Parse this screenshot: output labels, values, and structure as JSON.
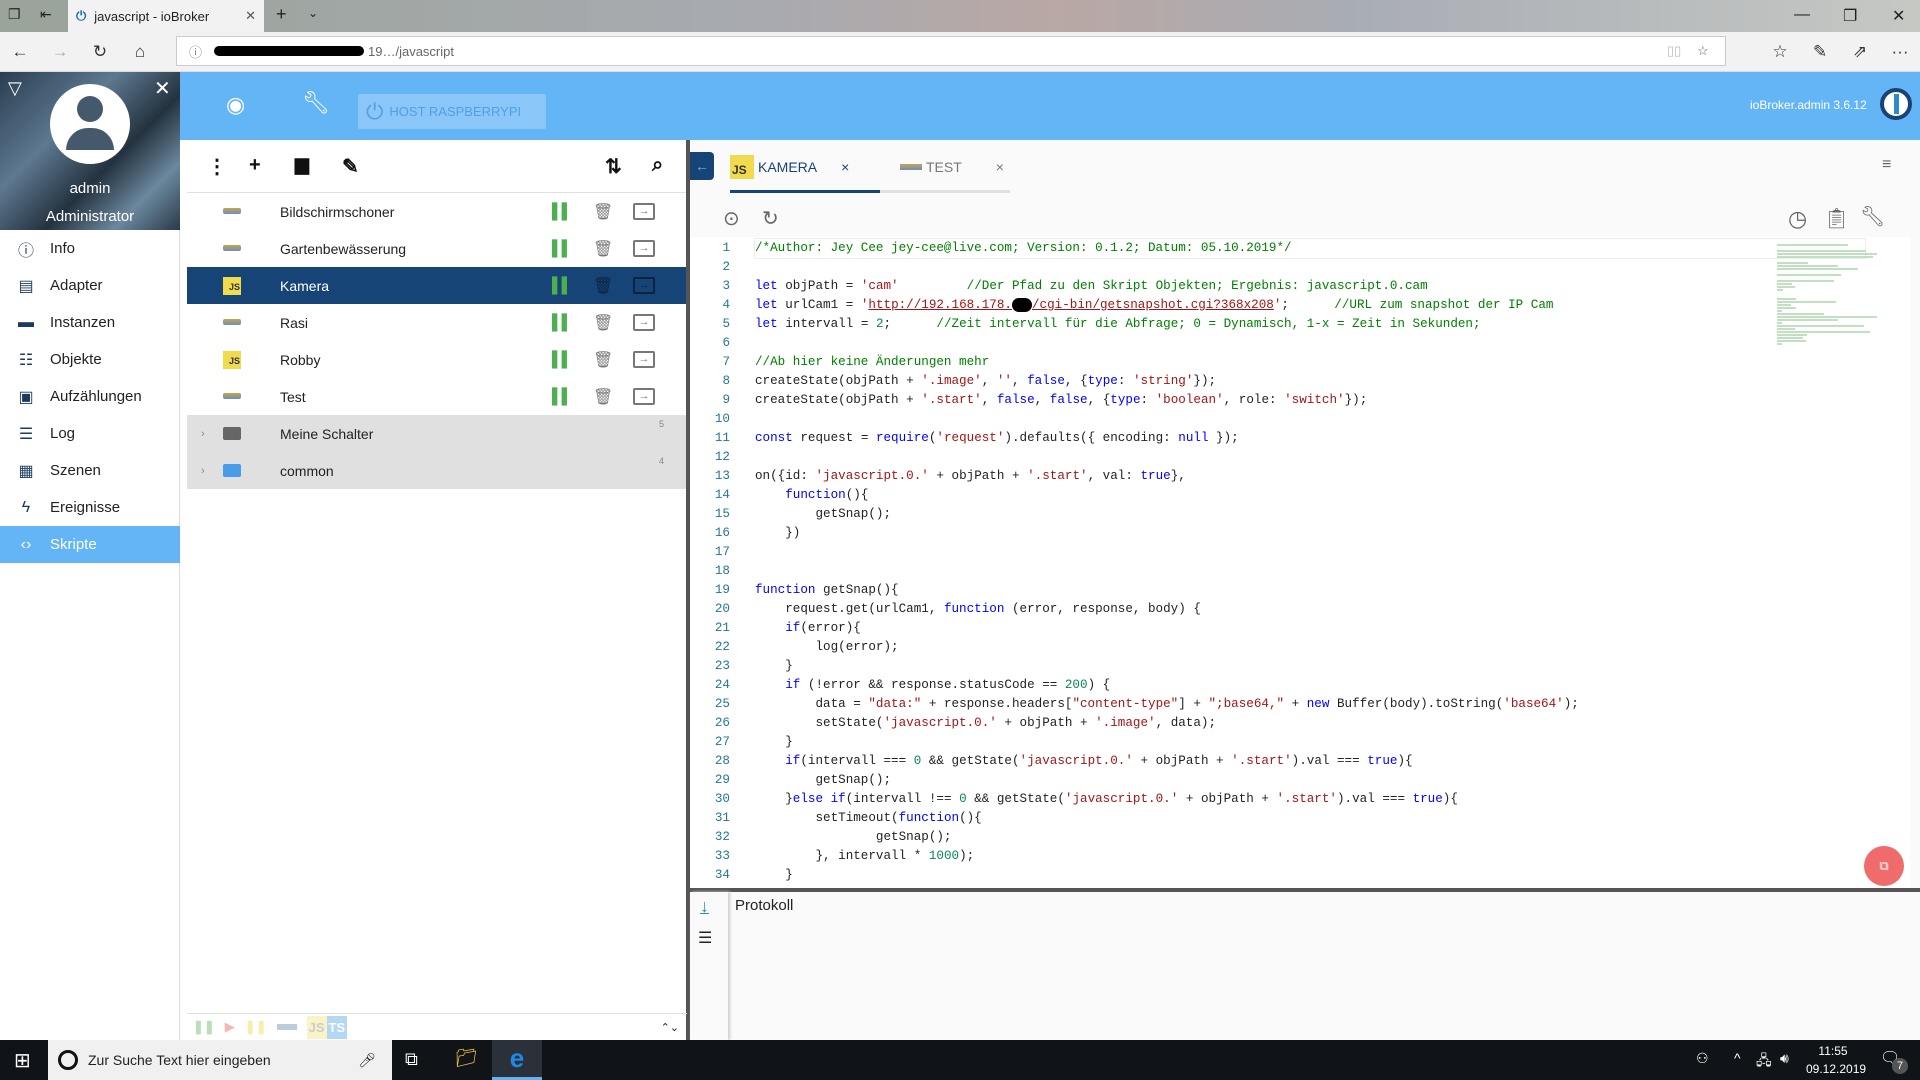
{
  "browser": {
    "tab_title": "javascript - ioBroker",
    "url_visible": "19…/javascript",
    "new_tab": "+"
  },
  "header": {
    "host_button": "HOST RASPBERRYPI",
    "version": "ioBroker.admin 3.6.12",
    "accent": "#64b5f6"
  },
  "user": {
    "name": "admin",
    "role": "Administrator"
  },
  "sidebar": {
    "items": [
      {
        "label": "Info",
        "icon": "info-icon"
      },
      {
        "label": "Adapter",
        "icon": "store-icon"
      },
      {
        "label": "Instanzen",
        "icon": "instances-icon"
      },
      {
        "label": "Objekte",
        "icon": "list-icon"
      },
      {
        "label": "Aufzählungen",
        "icon": "enum-icon"
      },
      {
        "label": "Log",
        "icon": "log-icon"
      },
      {
        "label": "Szenen",
        "icon": "scenes-icon"
      },
      {
        "label": "Ereignisse",
        "icon": "flash-icon"
      },
      {
        "label": "Skripte",
        "icon": "code-icon",
        "active": true
      }
    ]
  },
  "scripts": {
    "items": [
      {
        "name": "Bildschirmschoner",
        "type": "blockly"
      },
      {
        "name": "Gartenbewässerung",
        "type": "blockly"
      },
      {
        "name": "Kamera",
        "type": "js",
        "selected": true
      },
      {
        "name": "Rasi",
        "type": "blockly"
      },
      {
        "name": "Robby",
        "type": "js"
      },
      {
        "name": "Test",
        "type": "blockly"
      }
    ],
    "folders": [
      {
        "name": "Meine Schalter",
        "count": "5",
        "color": "#666"
      },
      {
        "name": "common",
        "count": "4",
        "color": "#4a9be8"
      }
    ],
    "filter_labels": {
      "js": "JS",
      "ts": "TS"
    }
  },
  "editor": {
    "tabs": [
      {
        "label": "KAMERA",
        "badge": "JS",
        "active": true
      },
      {
        "label": "TEST",
        "badge": ""
      }
    ],
    "close": "×",
    "log_title": "Protokoll",
    "code": [
      [
        [
          "c",
          "/*Author: Jey Cee jey-cee@live.com; Version: 0.1.2; Datum: 05.10.2019*/"
        ]
      ],
      [],
      [
        [
          "k",
          "let"
        ],
        [
          "p",
          " objPath = "
        ],
        [
          "s",
          "'cam'"
        ],
        [
          "p",
          "         "
        ],
        [
          "c",
          "//Der Pfad zu den Skript Objekten; Ergebnis: javascript.0.cam"
        ]
      ],
      [
        [
          "k",
          "let"
        ],
        [
          "p",
          " urlCam1 = "
        ],
        [
          "s",
          "'"
        ],
        [
          "u",
          "http://192.168.178."
        ],
        [
          "r",
          ""
        ],
        [
          "u",
          "/cgi-bin/getsnapshot.cgi?368x208"
        ],
        [
          "s",
          "'"
        ],
        [
          "p",
          ";      "
        ],
        [
          "c",
          "//URL zum snapshot der IP Cam"
        ]
      ],
      [
        [
          "k",
          "let"
        ],
        [
          "p",
          " intervall = "
        ],
        [
          "n",
          "2"
        ],
        [
          "p",
          ";      "
        ],
        [
          "c",
          "//Zeit intervall für die Abfrage; 0 = Dynamisch, 1-x = Zeit in Sekunden;"
        ]
      ],
      [],
      [
        [
          "c",
          "//Ab hier keine Änderungen mehr"
        ]
      ],
      [
        [
          "p",
          "createState(objPath + "
        ],
        [
          "s",
          "'.image'"
        ],
        [
          "p",
          ", "
        ],
        [
          "s",
          "''"
        ],
        [
          "p",
          ", "
        ],
        [
          "k",
          "false"
        ],
        [
          "p",
          ", {"
        ],
        [
          "k",
          "type"
        ],
        [
          "p",
          ": "
        ],
        [
          "s",
          "'string'"
        ],
        [
          "p",
          "});"
        ]
      ],
      [
        [
          "p",
          "createState(objPath + "
        ],
        [
          "s",
          "'.start'"
        ],
        [
          "p",
          ", "
        ],
        [
          "k",
          "false"
        ],
        [
          "p",
          ", "
        ],
        [
          "k",
          "false"
        ],
        [
          "p",
          ", {"
        ],
        [
          "k",
          "type"
        ],
        [
          "p",
          ": "
        ],
        [
          "s",
          "'boolean'"
        ],
        [
          "p",
          ", role: "
        ],
        [
          "s",
          "'switch'"
        ],
        [
          "p",
          "});"
        ]
      ],
      [],
      [
        [
          "k",
          "const"
        ],
        [
          "p",
          " request = "
        ],
        [
          "k",
          "require"
        ],
        [
          "p",
          "("
        ],
        [
          "s",
          "'request'"
        ],
        [
          "p",
          ").defaults({ encoding: "
        ],
        [
          "k",
          "null"
        ],
        [
          "p",
          " });"
        ]
      ],
      [],
      [
        [
          "p",
          "on({id: "
        ],
        [
          "s",
          "'javascript.0.'"
        ],
        [
          "p",
          " + objPath + "
        ],
        [
          "s",
          "'.start'"
        ],
        [
          "p",
          ", val: "
        ],
        [
          "k",
          "true"
        ],
        [
          "p",
          "},"
        ]
      ],
      [
        [
          "p",
          "    "
        ],
        [
          "k",
          "function"
        ],
        [
          "p",
          "(){"
        ]
      ],
      [
        [
          "p",
          "        getSnap();"
        ]
      ],
      [
        [
          "p",
          "    })"
        ]
      ],
      [],
      [],
      [
        [
          "k",
          "function"
        ],
        [
          "p",
          " getSnap(){"
        ]
      ],
      [
        [
          "p",
          "    request.get(urlCam1, "
        ],
        [
          "k",
          "function"
        ],
        [
          "p",
          " (error, response, body) {"
        ]
      ],
      [
        [
          "p",
          "    "
        ],
        [
          "k",
          "if"
        ],
        [
          "p",
          "(error){"
        ]
      ],
      [
        [
          "p",
          "        log(error);"
        ]
      ],
      [
        [
          "p",
          "    }"
        ]
      ],
      [
        [
          "p",
          "    "
        ],
        [
          "k",
          "if"
        ],
        [
          "p",
          " (!error && response.statusCode == "
        ],
        [
          "n",
          "200"
        ],
        [
          "p",
          ") {"
        ]
      ],
      [
        [
          "p",
          "        data = "
        ],
        [
          "s",
          "\"data:\""
        ],
        [
          "p",
          " + response.headers["
        ],
        [
          "s",
          "\"content-type\""
        ],
        [
          "p",
          "] + "
        ],
        [
          "s",
          "\";base64,\""
        ],
        [
          "p",
          " + "
        ],
        [
          "k",
          "new"
        ],
        [
          "p",
          " Buffer(body).toString("
        ],
        [
          "s",
          "'base64'"
        ],
        [
          "p",
          ");"
        ]
      ],
      [
        [
          "p",
          "        setState("
        ],
        [
          "s",
          "'javascript.0.'"
        ],
        [
          "p",
          " + objPath + "
        ],
        [
          "s",
          "'.image'"
        ],
        [
          "p",
          ", data);"
        ]
      ],
      [
        [
          "p",
          "    }"
        ]
      ],
      [
        [
          "p",
          "    "
        ],
        [
          "k",
          "if"
        ],
        [
          "p",
          "(intervall === "
        ],
        [
          "n",
          "0"
        ],
        [
          "p",
          " && getState("
        ],
        [
          "s",
          "'javascript.0.'"
        ],
        [
          "p",
          " + objPath + "
        ],
        [
          "s",
          "'.start'"
        ],
        [
          "p",
          ").val === "
        ],
        [
          "k",
          "true"
        ],
        [
          "p",
          "){"
        ]
      ],
      [
        [
          "p",
          "        getSnap();"
        ]
      ],
      [
        [
          "p",
          "    }"
        ],
        [
          "k",
          "else if"
        ],
        [
          "p",
          "(intervall !== "
        ],
        [
          "n",
          "0"
        ],
        [
          "p",
          " && getState("
        ],
        [
          "s",
          "'javascript.0.'"
        ],
        [
          "p",
          " + objPath + "
        ],
        [
          "s",
          "'.start'"
        ],
        [
          "p",
          ").val === "
        ],
        [
          "k",
          "true"
        ],
        [
          "p",
          "){"
        ]
      ],
      [
        [
          "p",
          "        setTimeout("
        ],
        [
          "k",
          "function"
        ],
        [
          "p",
          "(){"
        ]
      ],
      [
        [
          "p",
          "                getSnap();"
        ]
      ],
      [
        [
          "p",
          "        }, intervall * "
        ],
        [
          "n",
          "1000"
        ],
        [
          "p",
          ");"
        ]
      ],
      [
        [
          "p",
          "    }"
        ]
      ]
    ]
  },
  "taskbar": {
    "search_placeholder": "Zur Suche Text hier eingeben",
    "time": "11:55",
    "date": "09.12.2019",
    "notifications": "7"
  }
}
